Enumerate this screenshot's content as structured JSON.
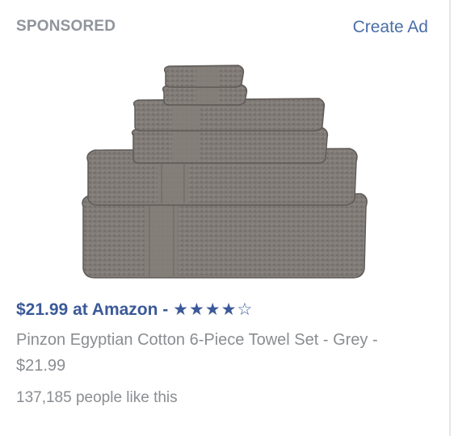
{
  "header": {
    "sponsored_label": "SPONSORED",
    "create_ad_label": "Create Ad"
  },
  "ad": {
    "price_source": "$21.99 at Amazon - ",
    "rating_stars": "★★★★☆",
    "rating_value": 4,
    "rating_max": 5,
    "description": "Pinzon Egyptian Cotton 6-Piece Towel Set - Grey - $21.99",
    "likes": "137,185 people like this"
  },
  "colors": {
    "link_blue": "#3b5998",
    "create_ad_blue": "#4a6ea8",
    "muted_gray": "#8a8d91",
    "towel_gray": "#7d7874"
  }
}
